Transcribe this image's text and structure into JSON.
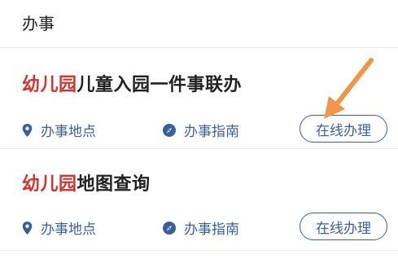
{
  "header": {
    "title": "办事"
  },
  "services": [
    {
      "title_highlight": "幼儿园",
      "title_rest": "儿童入园一件事联办",
      "location_label": "办事地点",
      "guide_label": "办事指南",
      "online_label": "在线办理"
    },
    {
      "title_highlight": "幼儿园",
      "title_rest": "地图查询",
      "location_label": "办事地点",
      "guide_label": "办事指南",
      "online_label": "在线办理"
    }
  ],
  "colors": {
    "highlight": "#d0342c",
    "action_blue": "#3a5f9e",
    "annotation_arrow": "#f0954a"
  },
  "icons": {
    "location": "location-pin-icon",
    "guide": "compass-icon"
  }
}
